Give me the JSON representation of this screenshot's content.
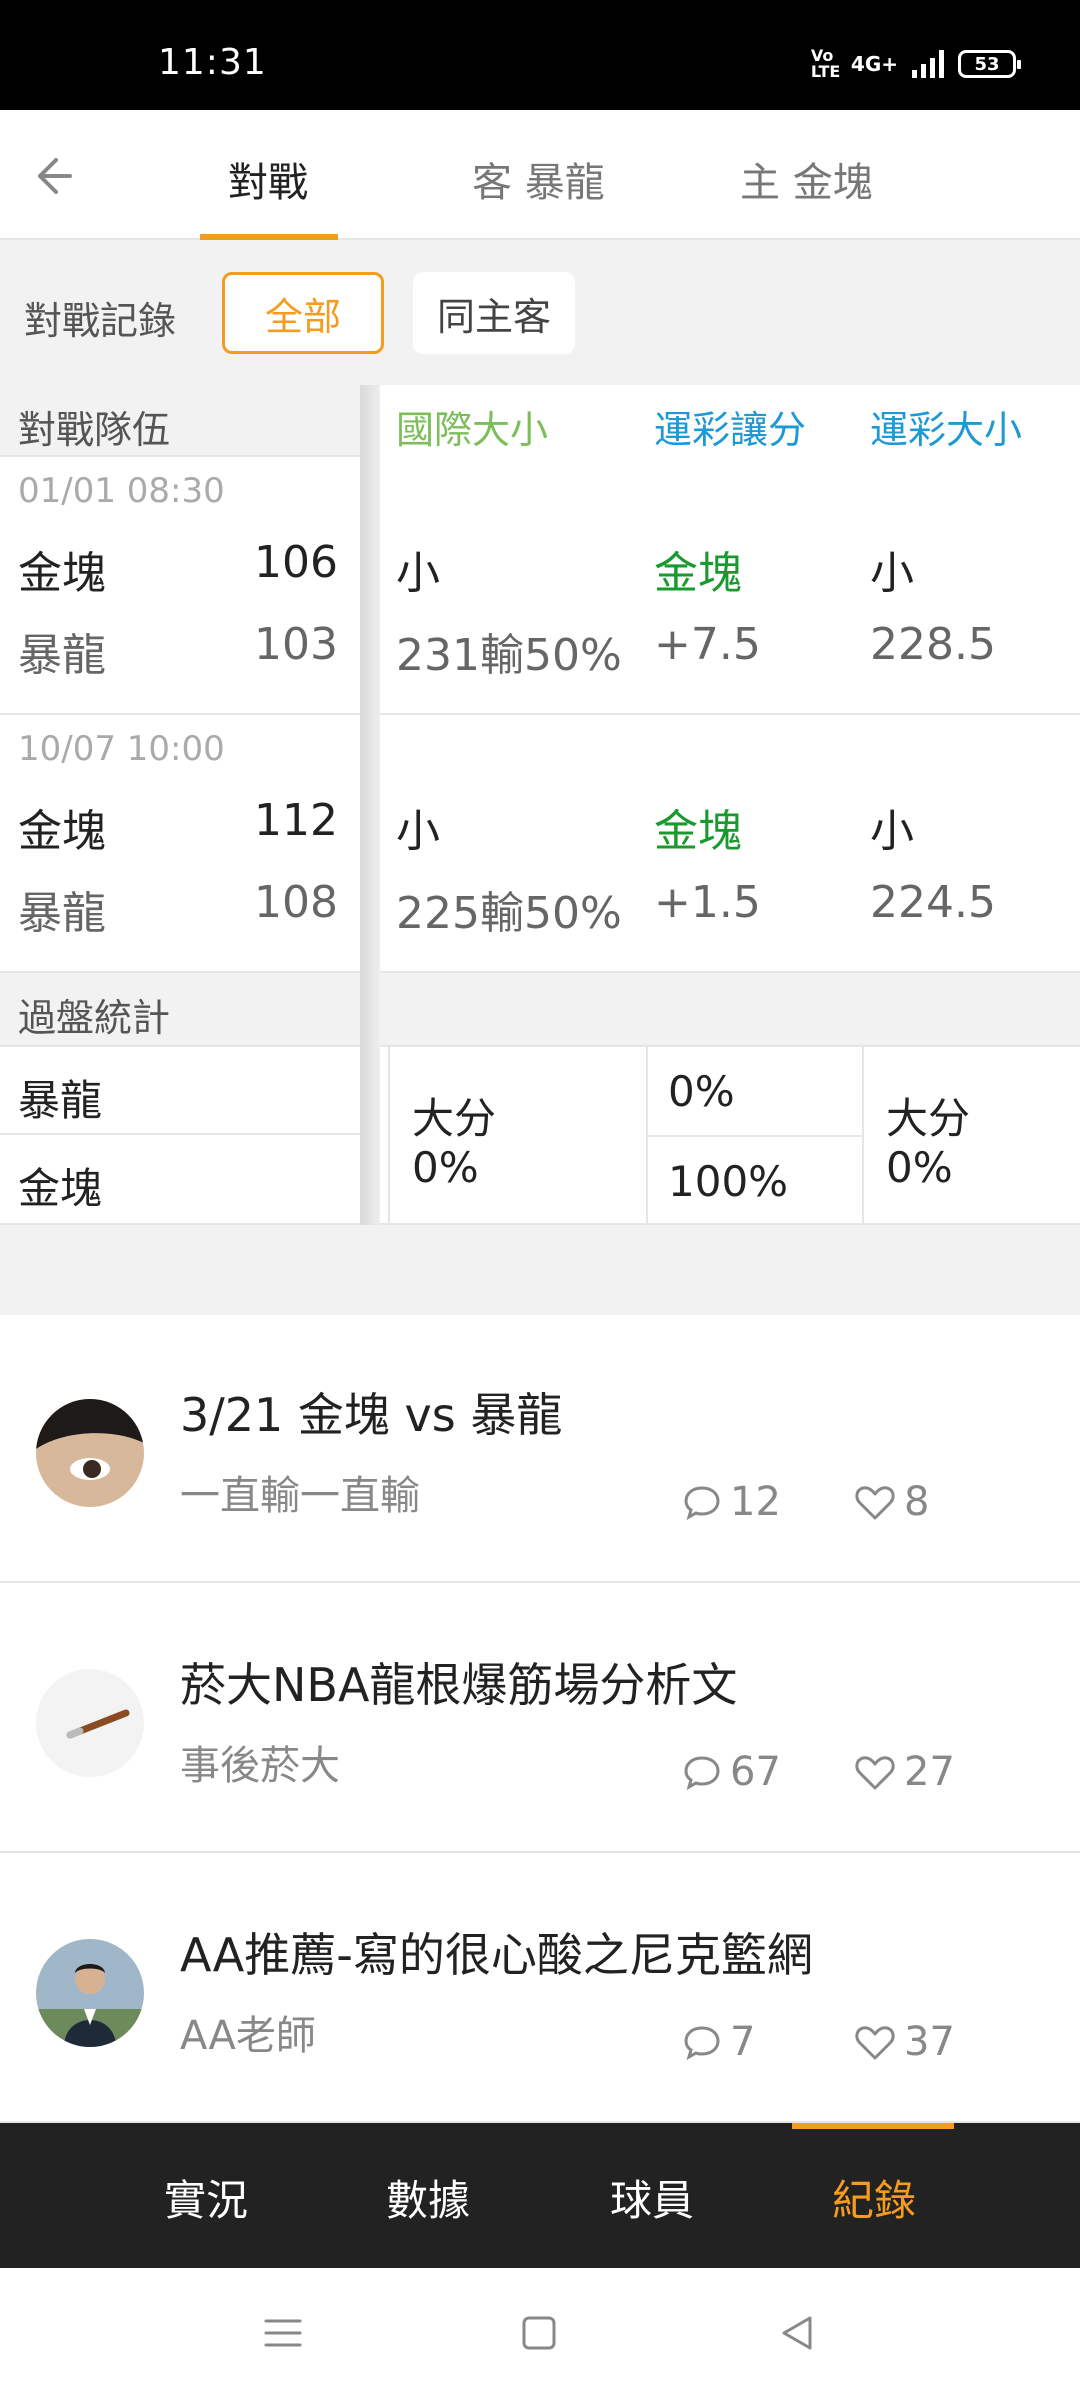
{
  "status_bar": {
    "time": "11:31",
    "network": "4G+",
    "volte": "Vo LTE",
    "battery": "53"
  },
  "top_nav": {
    "back_icon": "arrow-left-icon",
    "tabs": [
      {
        "label": "對戰",
        "active": true
      },
      {
        "label": "客 暴龍",
        "active": false
      },
      {
        "label": "主 金塊",
        "active": false
      }
    ]
  },
  "filter": {
    "label": "對戰記錄",
    "chips": [
      {
        "label": "全部",
        "active": true
      },
      {
        "label": "同主客",
        "active": false
      }
    ]
  },
  "table": {
    "headers": {
      "team": "對戰隊伍",
      "intl_ou": "國際大小",
      "lottery_spread": "運彩讓分",
      "lottery_ou": "運彩大小"
    },
    "header_colors": {
      "intl_ou": "#7cbf5a",
      "lottery_spread": "#1d9ad6",
      "lottery_ou": "#1d9ad6"
    },
    "matches": [
      {
        "date": "01/01 08:30",
        "home": {
          "name": "金塊",
          "score": "106",
          "intl": "小",
          "spread": "金塊",
          "ou": "小"
        },
        "away": {
          "name": "暴龍",
          "score": "103",
          "intl": "231輸50%",
          "spread": "+7.5",
          "ou": "228.5"
        }
      },
      {
        "date": "10/07 10:00",
        "home": {
          "name": "金塊",
          "score": "112",
          "intl": "小",
          "spread": "金塊",
          "ou": "小"
        },
        "away": {
          "name": "暴龍",
          "score": "108",
          "intl": "225輸50%",
          "spread": "+1.5",
          "ou": "224.5"
        }
      }
    ],
    "stats": {
      "label": "過盤統計",
      "teams": [
        "暴龍",
        "金塊"
      ],
      "intl_label": "大分",
      "intl_value": "0%",
      "spread_top": "0%",
      "spread_bottom": "100%",
      "ou_label": "大分",
      "ou_value": "0%"
    }
  },
  "posts": [
    {
      "title": "3/21 金塊 vs 暴龍",
      "author": "一直輸一直輸",
      "comments": "12",
      "likes": "8"
    },
    {
      "title": "菸大NBA龍根爆筋場分析文",
      "author": "事後菸大",
      "comments": "67",
      "likes": "27"
    },
    {
      "title": "AA推薦-寫的很心酸之尼克籃網",
      "author": "AA老師",
      "comments": "7",
      "likes": "37"
    }
  ],
  "bottom_tabs": [
    {
      "label": "實況",
      "active": false
    },
    {
      "label": "數據",
      "active": false
    },
    {
      "label": "球員",
      "active": false
    },
    {
      "label": "紀錄",
      "active": true
    }
  ],
  "colors": {
    "accent": "#f39c1f",
    "green": "#1a9a2e",
    "blue": "#1d9ad6",
    "light_green": "#7cbf5a",
    "bottom_bar": "#222222"
  }
}
